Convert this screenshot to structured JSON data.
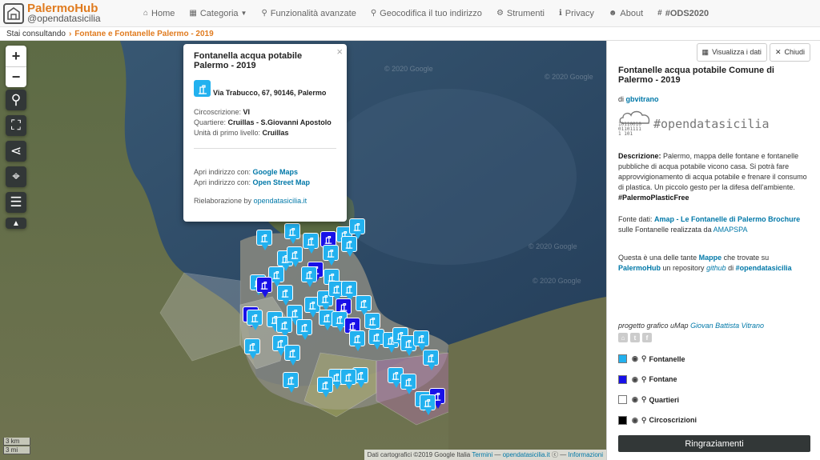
{
  "header": {
    "brand_title": "PalermoHub",
    "brand_subtitle": "@opendatasicilia",
    "nav": [
      {
        "icon": "home-icon",
        "label": "Home"
      },
      {
        "icon": "table-icon",
        "label": "Categoria"
      },
      {
        "icon": "search-icon",
        "label": "Funzionalità avanzate"
      },
      {
        "icon": "map-marker-icon",
        "label": "Geocodifica il tuo indirizzo"
      },
      {
        "icon": "gear-icon",
        "label": "Strumenti"
      },
      {
        "icon": "info-icon",
        "label": "Privacy"
      },
      {
        "icon": "users-icon",
        "label": "About"
      },
      {
        "icon": "hashtag-icon",
        "label": "#ODS2020"
      }
    ]
  },
  "breadcrumb": {
    "label": "Stai consultando",
    "current": "Fontane e Fontanelle Palermo - 2019"
  },
  "map": {
    "zoom_in": "+",
    "zoom_out": "−",
    "watermark": "© 2020 Google",
    "scale_km": "3 km",
    "scale_mi": "3 mi",
    "attribution_prefix": "Dati cartografici ©2019 Google Italia",
    "attribution_terms": "Termini",
    "attribution_sep": "—",
    "attribution_ods": "opendatasicilia.it",
    "attribution_info": "Informazioni",
    "accent_cyan": "#22b1ef",
    "accent_blue": "#1810e8"
  },
  "popup": {
    "title": "Fontanella acqua potabile Palermo - 2019",
    "address": "Via Trabucco, 67, 90146, Palermo",
    "circoscrizione_label": "Circoscrizione:",
    "circoscrizione_value": "VI",
    "quartiere_label": "Quartiere:",
    "quartiere_value": "Cruillas - S.Giovanni Apostolo",
    "unita_label": "Unità di primo livello:",
    "unita_value": "Cruillas",
    "open_with_1": "Apri indirizzo con:",
    "link_google": "Google Maps",
    "open_with_2": "Apri indirizzo con:",
    "link_osm": "Open Street Map",
    "credit_label": "Rielaborazione by",
    "credit_link": "opendatasicilia.it",
    "close": "×"
  },
  "panel": {
    "btn_data": "Visualizza i dati",
    "btn_close": "Chiudi",
    "title": "Fontanelle acqua potabile Comune di Palermo - 2019",
    "author_prefix": "di",
    "author": "gbvitrano",
    "logo_bits": [
      "10110010",
      "01101111",
      " 1  101"
    ],
    "logo_tag": "#opendatasicilia",
    "desc_label": "Descrizione:",
    "desc_text": "Palermo, mappa delle fontane e fontanelle pubbliche di acqua potabile vicono casa. Si potrà fare approvvigionamento di acqua potabile e frenare il consumo di plastica. Un piccolo gesto per la difesa dell'ambiente.",
    "desc_tag": "#PalermoPlasticFree",
    "source_label": "Fonte dati:",
    "source_link": "Amap - Le Fontanelle di Palermo",
    "source_brochure": "Brochure",
    "source_mid": "sulle Fontanelle realizzata da",
    "source_amap": "AMAPSPA",
    "more_1": "Questa è una delle tante",
    "more_mappe": "Mappe",
    "more_2": "che trovate su",
    "more_hub": "PalermoHub",
    "more_3": "un repository",
    "more_github": "github",
    "more_4": "di",
    "more_ods": "#opendatasicilia",
    "credits_prefix": "progetto grafico uMap",
    "credits_author": "Giovan Battista Vitrano",
    "legend": [
      {
        "label": "Fontanelle",
        "color": "#22b1ef"
      },
      {
        "label": "Fontane",
        "color": "#1810e8"
      },
      {
        "label": "Quartieri",
        "color": "#ffffff"
      },
      {
        "label": "Circoscrizioni",
        "color": "#000000"
      }
    ],
    "thanks": "Ringraziamenti"
  }
}
